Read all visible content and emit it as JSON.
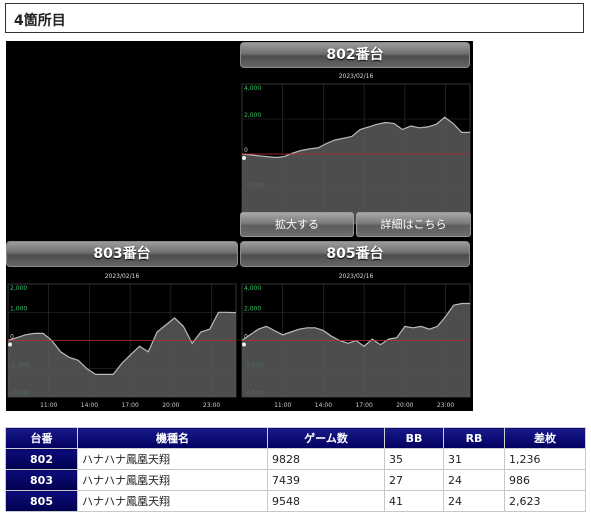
{
  "heading": {
    "title": "4箇所目"
  },
  "charts": [
    {
      "title": "802番台",
      "date": "2023/02/16",
      "y_ticks": [
        "4,000",
        "2,000",
        "0",
        "-2,000",
        "-4,000"
      ],
      "x_ticks": [
        "11:00",
        "14:00",
        "17:00",
        "20:00",
        "23:00"
      ],
      "ylim": [
        -4000,
        4000
      ],
      "values": [
        0,
        -50,
        -100,
        -150,
        -200,
        -150,
        50,
        200,
        300,
        350,
        600,
        800,
        900,
        1000,
        1400,
        1550,
        1700,
        1800,
        1750,
        1400,
        1600,
        1500,
        1550,
        1700,
        2100,
        1750,
        1236,
        1236
      ]
    },
    {
      "title": "803番台",
      "date": "2023/02/16",
      "y_ticks": [
        "2,000",
        "1,000",
        "0",
        "-1,000",
        "-2,000"
      ],
      "x_ticks": [
        "11:00",
        "14:00",
        "17:00",
        "20:00",
        "23:00"
      ],
      "ylim": [
        -2000,
        2000
      ],
      "values": [
        0,
        100,
        200,
        250,
        250,
        0,
        -400,
        -600,
        -700,
        -1000,
        -1200,
        -1200,
        -1200,
        -800,
        -500,
        -200,
        -400,
        300,
        550,
        800,
        500,
        -100,
        300,
        400,
        1000,
        1000,
        986
      ]
    },
    {
      "title": "805番台",
      "date": "2023/02/16",
      "y_ticks": [
        "4,000",
        "2,000",
        "0",
        "-2,000",
        "-4,000"
      ],
      "x_ticks": [
        "11:00",
        "14:00",
        "17:00",
        "20:00",
        "23:00"
      ],
      "ylim": [
        -4000,
        4000
      ],
      "values": [
        0,
        400,
        800,
        1000,
        700,
        400,
        600,
        800,
        900,
        900,
        700,
        300,
        0,
        -200,
        0,
        -400,
        100,
        -300,
        100,
        200,
        1000,
        900,
        1000,
        800,
        1000,
        1700,
        2500,
        2623,
        2623
      ]
    }
  ],
  "buttons": {
    "zoom": "拡大する",
    "detail": "詳細はこちら"
  },
  "table": {
    "headers": [
      "台番",
      "機種名",
      "ゲーム数",
      "BB",
      "RB",
      "差枚"
    ],
    "rows": [
      [
        "802",
        "ハナハナ鳳凰天翔",
        "9828",
        "35",
        "31",
        "1,236"
      ],
      [
        "803",
        "ハナハナ鳳凰天翔",
        "7439",
        "27",
        "24",
        "986"
      ],
      [
        "805",
        "ハナハナ鳳凰天翔",
        "9548",
        "41",
        "24",
        "2,623"
      ]
    ]
  }
}
